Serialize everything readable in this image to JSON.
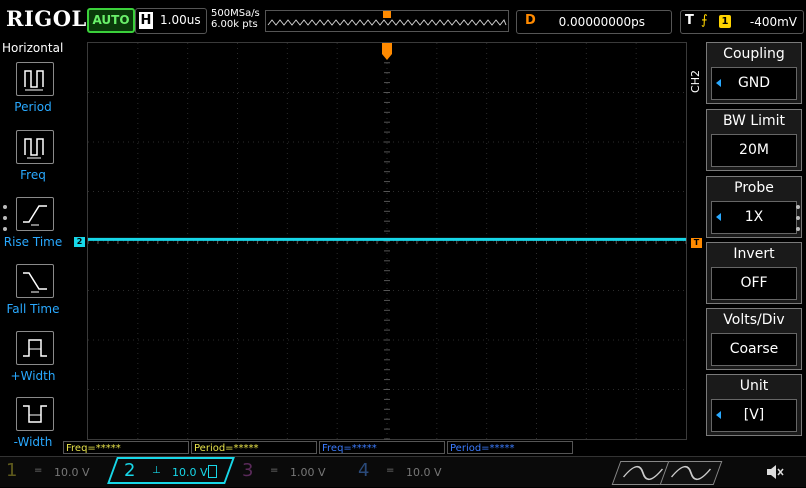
{
  "header": {
    "brand": "RIGOL",
    "run_mode": "AUTO",
    "timebase_label": "H",
    "timebase_value": "1.00us",
    "sample_rate": "500MSa/s",
    "memory_depth": "6.00k pts",
    "delay_label": "D",
    "delay_value": "0.00000000ps",
    "trigger_type": "T",
    "trigger_source": "1",
    "trigger_level": "-400mV"
  },
  "left_panel": {
    "title": "Horizontal",
    "items": [
      {
        "label": "Period",
        "icon": "period-icon"
      },
      {
        "label": "Freq",
        "icon": "freq-icon"
      },
      {
        "label": "Rise Time",
        "icon": "rise-time-icon"
      },
      {
        "label": "Fall Time",
        "icon": "fall-time-icon"
      },
      {
        "label": "+Width",
        "icon": "positive-width-icon"
      },
      {
        "label": "-Width",
        "icon": "negative-width-icon"
      }
    ]
  },
  "waveform": {
    "channel_marker": "2",
    "trigger_marker": "T",
    "color": "#17d7e8",
    "trigger_color": "#ff8a00",
    "level_fraction": 0.496
  },
  "right_menu": {
    "channel": "CH2",
    "items": [
      {
        "title": "Coupling",
        "value": "GND",
        "arrow": true
      },
      {
        "title": "BW Limit",
        "value": "20M",
        "arrow": false
      },
      {
        "title": "Probe",
        "value": "1X",
        "arrow": true
      },
      {
        "title": "Invert",
        "value": "OFF",
        "arrow": false
      },
      {
        "title": "Volts/Div",
        "value": "Coarse",
        "arrow": false
      },
      {
        "title": "Unit",
        "value": "[V]",
        "arrow": true
      }
    ]
  },
  "measurements": [
    {
      "text": "Freq=*****",
      "color": "#e8e34a"
    },
    {
      "text": "Period=*****",
      "color": "#e8e34a"
    },
    {
      "text": "Freq=*****",
      "color": "#3a7bff"
    },
    {
      "text": "Period=*****",
      "color": "#3a7bff"
    }
  ],
  "channels": [
    {
      "num": "1",
      "coupling": "=",
      "scale": "10.0 V",
      "color": "#5f5a1c"
    },
    {
      "num": "2",
      "coupling": "⊥",
      "scale": "10.0 V",
      "color": "#17d7e8"
    },
    {
      "num": "3",
      "coupling": "=",
      "scale": "1.00 V",
      "color": "#5a2a5a"
    },
    {
      "num": "4",
      "coupling": "=",
      "scale": "10.0 V",
      "color": "#2a4a7a"
    }
  ],
  "icons": {
    "sound": "speaker-muted-icon"
  }
}
